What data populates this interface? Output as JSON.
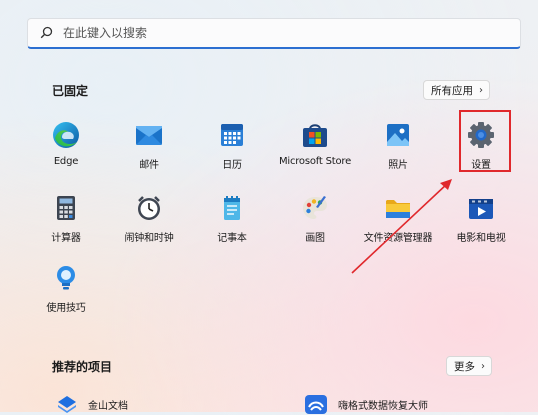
{
  "search": {
    "placeholder": "在此键入以搜索"
  },
  "pinned": {
    "title": "已固定",
    "all_apps_label": "所有应用",
    "apps": [
      {
        "label": "Edge",
        "icon": "edge-icon"
      },
      {
        "label": "邮件",
        "icon": "mail-icon"
      },
      {
        "label": "日历",
        "icon": "calendar-icon"
      },
      {
        "label": "Microsoft Store",
        "icon": "store-icon"
      },
      {
        "label": "照片",
        "icon": "photos-icon"
      },
      {
        "label": "设置",
        "icon": "settings-gear-icon"
      },
      {
        "label": "计算器",
        "icon": "calculator-icon"
      },
      {
        "label": "闹钟和时钟",
        "icon": "alarm-clock-icon"
      },
      {
        "label": "记事本",
        "icon": "notepad-icon"
      },
      {
        "label": "画图",
        "icon": "paint-icon"
      },
      {
        "label": "文件资源管理器",
        "icon": "folder-icon"
      },
      {
        "label": "电影和电视",
        "icon": "movies-tv-icon"
      },
      {
        "label": "使用技巧",
        "icon": "tips-icon"
      }
    ]
  },
  "recommended": {
    "title": "推荐的项目",
    "more_label": "更多",
    "items": [
      {
        "label": "金山文档",
        "icon": "kdocs-icon"
      },
      {
        "label": "嗨格式数据恢复大师",
        "icon": "recovery-app-icon"
      }
    ]
  },
  "colors": {
    "accent": "#2c6fd1",
    "highlight_box": "#e0282c"
  }
}
